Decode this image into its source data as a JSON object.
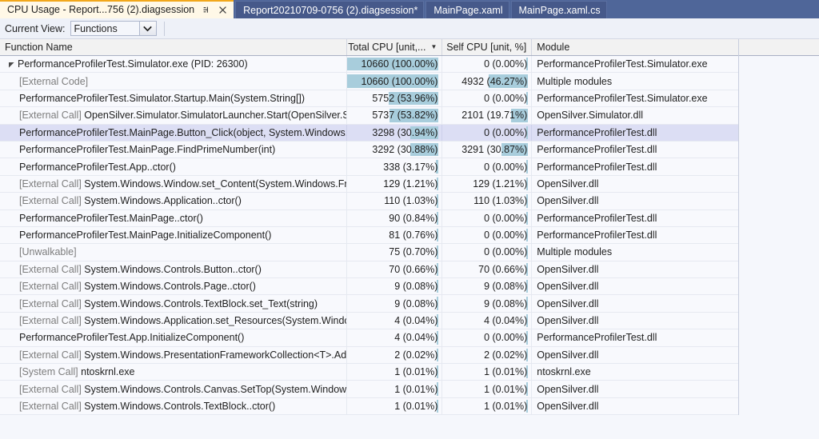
{
  "tabs": [
    {
      "label": "CPU Usage - Report...756 (2).diagsession",
      "active": true,
      "pin_icon": "pin-icon",
      "close_icon": "close-icon"
    },
    {
      "label": "Report20210709-0756 (2).diagsession*",
      "active": false
    },
    {
      "label": "MainPage.xaml",
      "active": false
    },
    {
      "label": "MainPage.xaml.cs",
      "active": false
    }
  ],
  "toolbar": {
    "current_view_label": "Current View:",
    "current_view_value": "Functions",
    "dropdown_icon": "chevron-down-icon"
  },
  "grid": {
    "columns": [
      {
        "key": "function",
        "label": "Function Name",
        "align": "left"
      },
      {
        "key": "total_cpu",
        "label": "Total CPU [unit,...",
        "align": "right",
        "sorted": true,
        "sort_icon": "sort-descending-caret"
      },
      {
        "key": "self_cpu",
        "label": "Self CPU [unit, %]",
        "align": "right"
      },
      {
        "key": "module",
        "label": "Module",
        "align": "left"
      }
    ],
    "rows": [
      {
        "indent": 0,
        "expander": "expanded",
        "prefix": "",
        "function": "PerformanceProfilerTest.Simulator.exe (PID: 26300)",
        "total_cpu": "10660 (100.00%)",
        "total_pct": 100.0,
        "self_cpu": "0 (0.00%)",
        "self_pct": 0.0,
        "module": "PerformanceProfilerTest.Simulator.exe",
        "selected": false
      },
      {
        "indent": 1,
        "expander": "none",
        "prefix": "[External Code]",
        "function": "",
        "total_cpu": "10660 (100.00%)",
        "total_pct": 100.0,
        "self_cpu": "4932 (46.27%)",
        "self_pct": 46.27,
        "module": "Multiple modules",
        "selected": false
      },
      {
        "indent": 1,
        "expander": "none",
        "prefix": "",
        "function": "PerformanceProfilerTest.Simulator.Startup.Main(System.String[])",
        "total_cpu": "5752 (53.96%)",
        "total_pct": 53.96,
        "self_cpu": "0 (0.00%)",
        "self_pct": 0.0,
        "module": "PerformanceProfilerTest.Simulator.exe",
        "selected": false
      },
      {
        "indent": 1,
        "expander": "none",
        "prefix": "[External Call]",
        "function": "OpenSilver.Simulator.SimulatorLauncher.Start(OpenSilver.Si...",
        "total_cpu": "5737 (53.82%)",
        "total_pct": 53.82,
        "self_cpu": "2101 (19.71%)",
        "self_pct": 19.71,
        "module": "OpenSilver.Simulator.dll",
        "selected": false
      },
      {
        "indent": 1,
        "expander": "none",
        "prefix": "",
        "function": "PerformanceProfilerTest.MainPage.Button_Click(object, System.Windows.R...",
        "total_cpu": "3298 (30.94%)",
        "total_pct": 30.94,
        "self_cpu": "0 (0.00%)",
        "self_pct": 0.0,
        "module": "PerformanceProfilerTest.dll",
        "selected": true
      },
      {
        "indent": 1,
        "expander": "none",
        "prefix": "",
        "function": "PerformanceProfilerTest.MainPage.FindPrimeNumber(int)",
        "total_cpu": "3292 (30.88%)",
        "total_pct": 30.88,
        "self_cpu": "3291 (30.87%)",
        "self_pct": 30.87,
        "module": "PerformanceProfilerTest.dll",
        "selected": false
      },
      {
        "indent": 1,
        "expander": "none",
        "prefix": "",
        "function": "PerformanceProfilerTest.App..ctor()",
        "total_cpu": "338 (3.17%)",
        "total_pct": 3.17,
        "self_cpu": "0 (0.00%)",
        "self_pct": 0.0,
        "module": "PerformanceProfilerTest.dll",
        "selected": false
      },
      {
        "indent": 1,
        "expander": "none",
        "prefix": "[External Call]",
        "function": "System.Windows.Window.set_Content(System.Windows.Fra...",
        "total_cpu": "129 (1.21%)",
        "total_pct": 1.21,
        "self_cpu": "129 (1.21%)",
        "self_pct": 1.21,
        "module": "OpenSilver.dll",
        "selected": false
      },
      {
        "indent": 1,
        "expander": "none",
        "prefix": "[External Call]",
        "function": "System.Windows.Application..ctor()",
        "total_cpu": "110 (1.03%)",
        "total_pct": 1.03,
        "self_cpu": "110 (1.03%)",
        "self_pct": 1.03,
        "module": "OpenSilver.dll",
        "selected": false
      },
      {
        "indent": 1,
        "expander": "none",
        "prefix": "",
        "function": "PerformanceProfilerTest.MainPage..ctor()",
        "total_cpu": "90 (0.84%)",
        "total_pct": 0.84,
        "self_cpu": "0 (0.00%)",
        "self_pct": 0.0,
        "module": "PerformanceProfilerTest.dll",
        "selected": false
      },
      {
        "indent": 1,
        "expander": "none",
        "prefix": "",
        "function": "PerformanceProfilerTest.MainPage.InitializeComponent()",
        "total_cpu": "81 (0.76%)",
        "total_pct": 0.76,
        "self_cpu": "0 (0.00%)",
        "self_pct": 0.0,
        "module": "PerformanceProfilerTest.dll",
        "selected": false
      },
      {
        "indent": 1,
        "expander": "none",
        "prefix": "[Unwalkable]",
        "function": "",
        "total_cpu": "75 (0.70%)",
        "total_pct": 0.7,
        "self_cpu": "0 (0.00%)",
        "self_pct": 0.0,
        "module": "Multiple modules",
        "selected": false
      },
      {
        "indent": 1,
        "expander": "none",
        "prefix": "[External Call]",
        "function": "System.Windows.Controls.Button..ctor()",
        "total_cpu": "70 (0.66%)",
        "total_pct": 0.66,
        "self_cpu": "70 (0.66%)",
        "self_pct": 0.66,
        "module": "OpenSilver.dll",
        "selected": false
      },
      {
        "indent": 1,
        "expander": "none",
        "prefix": "[External Call]",
        "function": "System.Windows.Controls.Page..ctor()",
        "total_cpu": "9 (0.08%)",
        "total_pct": 0.08,
        "self_cpu": "9 (0.08%)",
        "self_pct": 0.08,
        "module": "OpenSilver.dll",
        "selected": false
      },
      {
        "indent": 1,
        "expander": "none",
        "prefix": "[External Call]",
        "function": "System.Windows.Controls.TextBlock.set_Text(string)",
        "total_cpu": "9 (0.08%)",
        "total_pct": 0.08,
        "self_cpu": "9 (0.08%)",
        "self_pct": 0.08,
        "module": "OpenSilver.dll",
        "selected": false
      },
      {
        "indent": 1,
        "expander": "none",
        "prefix": "[External Call]",
        "function": "System.Windows.Application.set_Resources(System.Windows...",
        "total_cpu": "4 (0.04%)",
        "total_pct": 0.04,
        "self_cpu": "4 (0.04%)",
        "self_pct": 0.04,
        "module": "OpenSilver.dll",
        "selected": false
      },
      {
        "indent": 1,
        "expander": "none",
        "prefix": "",
        "function": "PerformanceProfilerTest.App.InitializeComponent()",
        "total_cpu": "4 (0.04%)",
        "total_pct": 0.04,
        "self_cpu": "0 (0.00%)",
        "self_pct": 0.0,
        "module": "PerformanceProfilerTest.dll",
        "selected": false
      },
      {
        "indent": 1,
        "expander": "none",
        "prefix": "[External Call]",
        "function": "System.Windows.PresentationFrameworkCollection<T>.Add(...",
        "total_cpu": "2 (0.02%)",
        "total_pct": 0.02,
        "self_cpu": "2 (0.02%)",
        "self_pct": 0.02,
        "module": "OpenSilver.dll",
        "selected": false
      },
      {
        "indent": 1,
        "expander": "none",
        "prefix": "[System Call]",
        "function": "ntoskrnl.exe",
        "total_cpu": "1 (0.01%)",
        "total_pct": 0.01,
        "self_cpu": "1 (0.01%)",
        "self_pct": 0.01,
        "module": "ntoskrnl.exe",
        "selected": false
      },
      {
        "indent": 1,
        "expander": "none",
        "prefix": "[External Call]",
        "function": "System.Windows.Controls.Canvas.SetTop(System.Windows.U...",
        "total_cpu": "1 (0.01%)",
        "total_pct": 0.01,
        "self_cpu": "1 (0.01%)",
        "self_pct": 0.01,
        "module": "OpenSilver.dll",
        "selected": false
      },
      {
        "indent": 1,
        "expander": "none",
        "prefix": "[External Call]",
        "function": "System.Windows.Controls.TextBlock..ctor()",
        "total_cpu": "1 (0.01%)",
        "total_pct": 0.01,
        "self_cpu": "1 (0.01%)",
        "self_pct": 0.01,
        "module": "OpenSilver.dll",
        "selected": false
      }
    ]
  },
  "colors": {
    "tabstrip_bg": "#4f6699",
    "active_tab_bg": "#fff8e7",
    "active_tab_accent": "#f2a71b",
    "inactive_tab_bg": "#46598a",
    "toolbar_bg": "#eef1f8",
    "grid_row_bg": "#f8f9fd",
    "grid_row_selected_bg": "#dcdef4",
    "data_bar": "#a8cddc",
    "header_bg": "#f2f2f2"
  }
}
